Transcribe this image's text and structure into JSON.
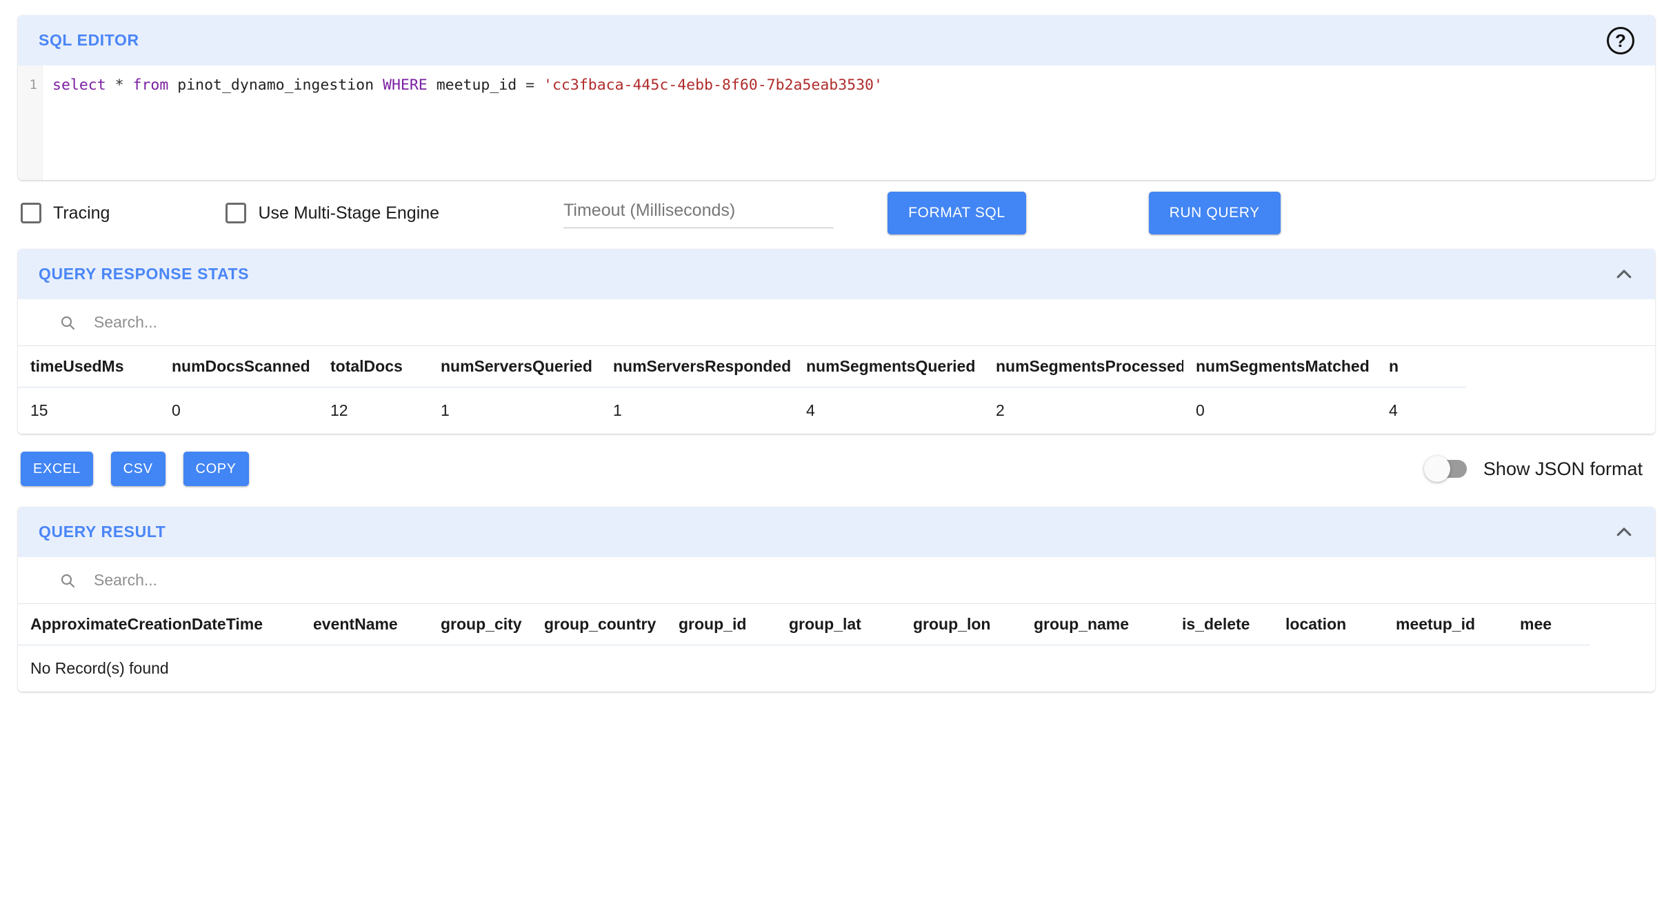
{
  "sql_editor": {
    "title": "SQL EDITOR",
    "help_icon": "help-circle-icon",
    "line_number": "1",
    "query_tokens": {
      "select": "select",
      "star": "*",
      "from": "from",
      "table": "pinot_dynamo_ingestion",
      "where": "WHERE",
      "column": "meetup_id",
      "equals": "=",
      "value": "'cc3fbaca-445c-4ebb-8f60-7b2a5eab3530'"
    },
    "query_full": "select * from pinot_dynamo_ingestion WHERE meetup_id = 'cc3fbaca-445c-4ebb-8f60-7b2a5eab3530'"
  },
  "controls": {
    "tracing_label": "Tracing",
    "tracing_checked": false,
    "multistage_label": "Use Multi-Stage Engine",
    "multistage_checked": false,
    "timeout_placeholder": "Timeout (Milliseconds)",
    "timeout_value": "",
    "format_sql_label": "FORMAT SQL",
    "run_query_label": "RUN QUERY"
  },
  "query_response_stats": {
    "title": "QUERY RESPONSE STATS",
    "collapse_icon": "chevron-up-icon",
    "search_placeholder": "Search...",
    "search_value": "",
    "search_icon": "search-icon",
    "columns": [
      "timeUsedMs",
      "numDocsScanned",
      "totalDocs",
      "numServersQueried",
      "numServersResponded",
      "numSegmentsQueried",
      "numSegmentsProcessed",
      "numSegmentsMatched",
      "n"
    ],
    "rows": [
      [
        "15",
        "0",
        "12",
        "1",
        "1",
        "4",
        "2",
        "0",
        "4"
      ]
    ]
  },
  "export": {
    "excel_label": "EXCEL",
    "csv_label": "CSV",
    "copy_label": "COPY",
    "json_toggle_label": "Show JSON format",
    "json_toggle_on": false
  },
  "query_result": {
    "title": "QUERY RESULT",
    "collapse_icon": "chevron-up-icon",
    "search_placeholder": "Search...",
    "search_value": "",
    "search_icon": "search-icon",
    "columns": [
      "ApproximateCreationDateTime",
      "eventName",
      "group_city",
      "group_country",
      "group_id",
      "group_lat",
      "group_lon",
      "group_name",
      "is_delete",
      "location",
      "meetup_id",
      "mee"
    ],
    "empty_message": "No Record(s) found",
    "rows": []
  },
  "colors": {
    "accent": "#4285f4",
    "header_bg": "#e8effc",
    "title_text": "#4a86f7",
    "string_literal": "#b02b2b",
    "keyword": "#7a1fa2"
  }
}
